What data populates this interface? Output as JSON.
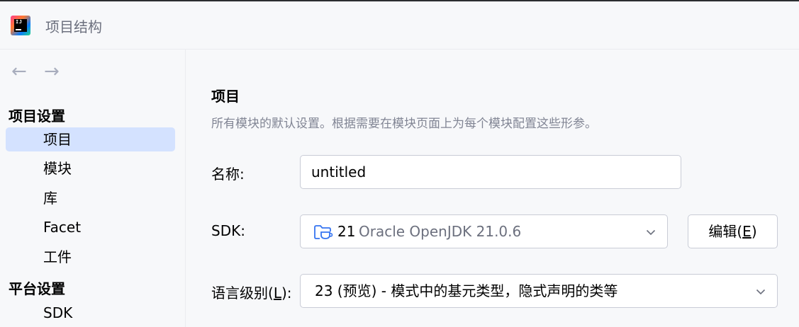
{
  "window": {
    "title": "项目结构",
    "logo_text": "IJ"
  },
  "nav": {
    "back_icon": "←",
    "forward_icon": "→"
  },
  "sidebar": {
    "sections": [
      {
        "header": "项目设置",
        "items": [
          {
            "label": "项目",
            "selected": true
          },
          {
            "label": "模块"
          },
          {
            "label": "库"
          },
          {
            "label": "Facet"
          },
          {
            "label": "工件"
          }
        ]
      },
      {
        "header": "平台设置",
        "items": [
          {
            "label": "SDK"
          }
        ]
      }
    ]
  },
  "content": {
    "heading": "项目",
    "description": "所有模块的默认设置。根据需要在模块页面上为每个模块配置这些形参。",
    "name_field": {
      "label": "名称:",
      "value": "untitled"
    },
    "sdk_field": {
      "label": "SDK:",
      "version": "21",
      "name": "Oracle OpenJDK 21.0.6",
      "edit_button_text": "编辑",
      "edit_button_mnemonic": "E"
    },
    "language_level_field": {
      "label_text": "语言级别",
      "label_mnemonic": "L",
      "value": "23 (预览) - 模式中的基元类型，隐式声明的类等"
    }
  },
  "colors": {
    "selection": "#d4e2ff",
    "muted_text": "#818594"
  }
}
